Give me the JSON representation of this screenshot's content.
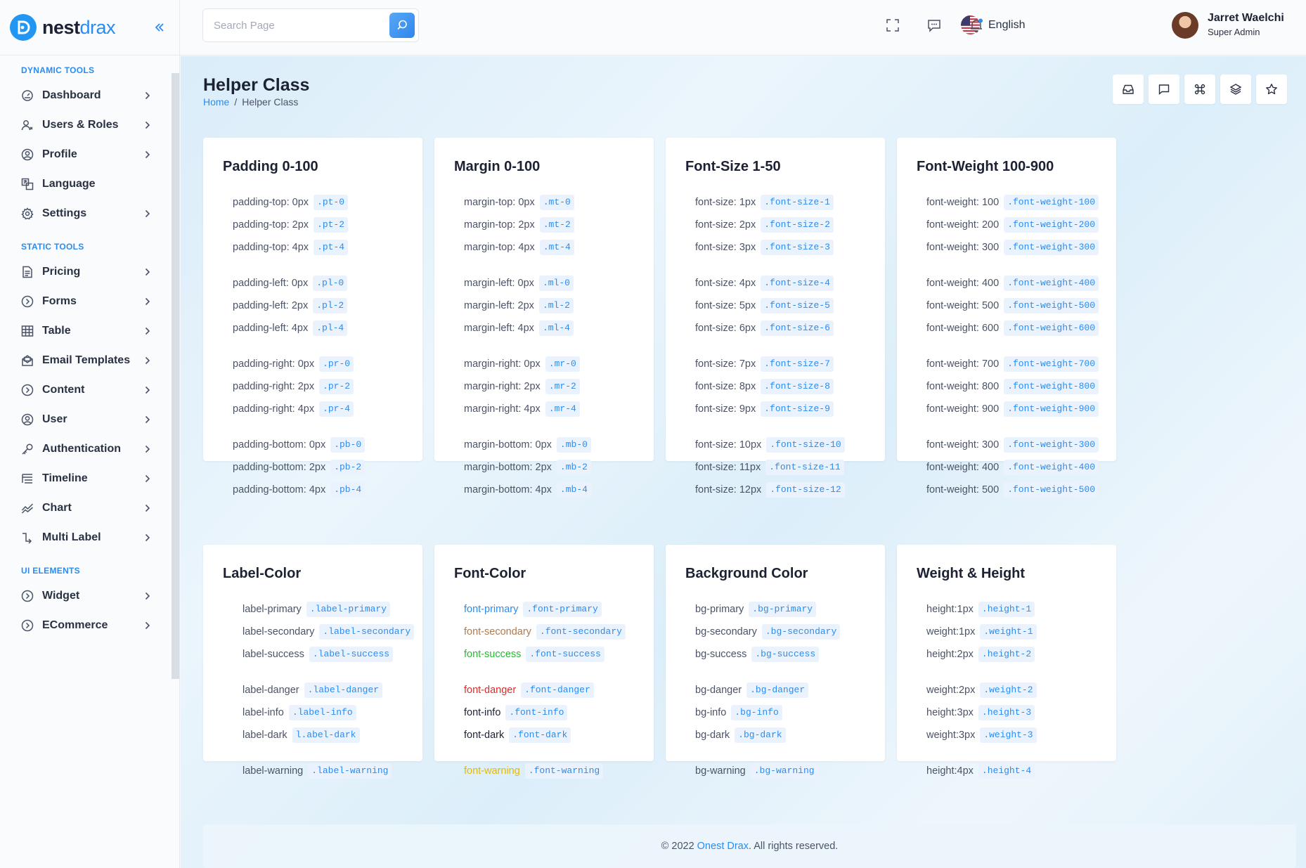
{
  "brand": {
    "name_main": "nest",
    "name_accent": "drax"
  },
  "sidebar": {
    "sections": [
      {
        "title": "DYNAMIC TOOLS",
        "items": [
          {
            "label": "Dashboard",
            "icon": "gauge-icon",
            "chevron": true
          },
          {
            "label": "Users & Roles",
            "icon": "users-icon",
            "chevron": true
          },
          {
            "label": "Profile",
            "icon": "profile-icon",
            "chevron": true
          },
          {
            "label": "Language",
            "icon": "language-icon",
            "chevron": false
          },
          {
            "label": "Settings",
            "icon": "gear-icon",
            "chevron": true
          }
        ]
      },
      {
        "title": "STATIC TOOLS",
        "items": [
          {
            "label": "Pricing",
            "icon": "pricing-icon",
            "chevron": true
          },
          {
            "label": "Forms",
            "icon": "circle-chevron-icon",
            "chevron": true
          },
          {
            "label": "Table",
            "icon": "table-icon",
            "chevron": true
          },
          {
            "label": "Email Templates",
            "icon": "mail-icon",
            "chevron": true
          },
          {
            "label": "Content",
            "icon": "circle-chevron-icon",
            "chevron": true
          },
          {
            "label": "User",
            "icon": "user-icon",
            "chevron": true
          },
          {
            "label": "Authentication",
            "icon": "key-icon",
            "chevron": true
          },
          {
            "label": "Timeline",
            "icon": "timeline-icon",
            "chevron": true
          },
          {
            "label": "Chart",
            "icon": "chart-icon",
            "chevron": true
          },
          {
            "label": "Multi Label",
            "icon": "multi-label-icon",
            "chevron": true
          }
        ]
      },
      {
        "title": "UI ELEMENTS",
        "items": [
          {
            "label": "Widget",
            "icon": "circle-chevron-icon",
            "chevron": true
          },
          {
            "label": "ECommerce",
            "icon": "circle-chevron-icon",
            "chevron": true
          }
        ]
      }
    ]
  },
  "header": {
    "search_placeholder": "Search Page",
    "language": "English",
    "user_name": "Jarret Waelchi",
    "user_role": "Super Admin"
  },
  "page": {
    "title": "Helper Class",
    "breadcrumb_home": "Home",
    "breadcrumb_sep": "/",
    "breadcrumb_current": "Helper Class"
  },
  "colors": {
    "accent": "#2b8cf0",
    "primary": "#2b8cf0",
    "secondary": "#b07a4f",
    "success": "#28b833",
    "danger": "#e02a2a",
    "dark": "#1c2233",
    "warning": "#e6b800"
  },
  "cards": [
    {
      "title": "Padding 0-100",
      "groups": [
        [
          [
            "padding-top: 0px",
            ".pt-0"
          ],
          [
            "padding-top: 2px",
            ".pt-2"
          ],
          [
            "padding-top: 4px",
            ".pt-4"
          ]
        ],
        [
          [
            "padding-left: 0px",
            ".pl-0"
          ],
          [
            "padding-left: 2px",
            ".pl-2"
          ],
          [
            "padding-left: 4px",
            ".pl-4"
          ]
        ],
        [
          [
            "padding-right: 0px",
            ".pr-0"
          ],
          [
            "padding-right: 2px",
            ".pr-2"
          ],
          [
            "padding-right: 4px",
            ".pr-4"
          ]
        ],
        [
          [
            "padding-bottom: 0px",
            ".pb-0"
          ],
          [
            "padding-bottom: 2px",
            ".pb-2"
          ],
          [
            "padding-bottom: 4px",
            ".pb-4"
          ]
        ]
      ]
    },
    {
      "title": "Margin 0-100",
      "groups": [
        [
          [
            "margin-top: 0px",
            ".mt-0"
          ],
          [
            "margin-top: 2px",
            ".mt-2"
          ],
          [
            "margin-top: 4px",
            ".mt-4"
          ]
        ],
        [
          [
            "margin-left: 0px",
            ".ml-0"
          ],
          [
            "margin-left: 2px",
            ".ml-2"
          ],
          [
            "margin-left: 4px",
            ".ml-4"
          ]
        ],
        [
          [
            "margin-right: 0px",
            ".mr-0"
          ],
          [
            "margin-right: 2px",
            ".mr-2"
          ],
          [
            "margin-right: 4px",
            ".mr-4"
          ]
        ],
        [
          [
            "margin-bottom: 0px",
            ".mb-0"
          ],
          [
            "margin-bottom: 2px",
            ".mb-2"
          ],
          [
            "margin-bottom: 4px",
            ".mb-4"
          ]
        ]
      ]
    },
    {
      "title": "Font-Size 1-50",
      "groups": [
        [
          [
            "font-size: 1px",
            ".font-size-1"
          ],
          [
            "font-size: 2px",
            ".font-size-2"
          ],
          [
            "font-size: 3px",
            ".font-size-3"
          ]
        ],
        [
          [
            "font-size: 4px",
            ".font-size-4"
          ],
          [
            "font-size: 5px",
            ".font-size-5"
          ],
          [
            "font-size: 6px",
            ".font-size-6"
          ]
        ],
        [
          [
            "font-size: 7px",
            ".font-size-7"
          ],
          [
            "font-size: 8px",
            ".font-size-8"
          ],
          [
            "font-size: 9px",
            ".font-size-9"
          ]
        ],
        [
          [
            "font-size: 10px",
            ".font-size-10"
          ],
          [
            "font-size: 11px",
            ".font-size-11"
          ],
          [
            "font-size: 12px",
            ".font-size-12"
          ]
        ]
      ]
    },
    {
      "title": "Font-Weight 100-900",
      "groups": [
        [
          [
            "font-weight: 100",
            ".font-weight-100"
          ],
          [
            "font-weight: 200",
            ".font-weight-200"
          ],
          [
            "font-weight: 300",
            ".font-weight-300"
          ]
        ],
        [
          [
            "font-weight: 400",
            ".font-weight-400"
          ],
          [
            "font-weight: 500",
            ".font-weight-500"
          ],
          [
            "font-weight: 600",
            ".font-weight-600"
          ]
        ],
        [
          [
            "font-weight: 700",
            ".font-weight-700"
          ],
          [
            "font-weight: 800",
            ".font-weight-800"
          ],
          [
            "font-weight: 900",
            ".font-weight-900"
          ]
        ],
        [
          [
            "font-weight: 300",
            ".font-weight-300"
          ],
          [
            "font-weight: 400",
            ".font-weight-400"
          ],
          [
            "font-weight: 500",
            ".font-weight-500"
          ]
        ]
      ]
    },
    {
      "title": "Label-Color",
      "groups": [
        [
          [
            "label-primary",
            ".label-primary"
          ],
          [
            "label-secondary",
            ".label-secondary"
          ],
          [
            "label-success",
            ".label-success"
          ]
        ],
        [
          [
            "label-danger",
            ".label-danger"
          ],
          [
            "label-info",
            ".label-info"
          ],
          [
            "label-dark",
            "l.abel-dark"
          ]
        ],
        [
          [
            "label-warning",
            ".label-warning"
          ]
        ]
      ]
    },
    {
      "title": "Font-Color",
      "groups": [
        [
          [
            "font-primary",
            ".font-primary",
            "primary"
          ],
          [
            "font-secondary",
            ".font-secondary",
            "secondary"
          ],
          [
            "font-success",
            ".font-success",
            "success"
          ]
        ],
        [
          [
            "font-danger",
            ".font-danger",
            "danger"
          ],
          [
            "font-info",
            ".font-info",
            "dark"
          ],
          [
            "font-dark",
            ".font-dark",
            "dark"
          ]
        ],
        [
          [
            "font-warning",
            ".font-warning",
            "warning"
          ]
        ]
      ]
    },
    {
      "title": "Background Color",
      "groups": [
        [
          [
            "bg-primary",
            ".bg-primary"
          ],
          [
            "bg-secondary",
            ".bg-secondary"
          ],
          [
            "bg-success",
            ".bg-success"
          ]
        ],
        [
          [
            "bg-danger",
            ".bg-danger"
          ],
          [
            "bg-info",
            ".bg-info"
          ],
          [
            "bg-dark",
            ".bg-dark"
          ]
        ],
        [
          [
            "bg-warning",
            ".bg-warning"
          ]
        ]
      ]
    },
    {
      "title": "Weight & Height",
      "groups": [
        [
          [
            "height:1px",
            ".height-1"
          ],
          [
            "weight:1px",
            ".weight-1"
          ],
          [
            "height:2px",
            ".height-2"
          ]
        ],
        [
          [
            "weight:2px",
            ".weight-2"
          ],
          [
            "height:3px",
            ".height-3"
          ],
          [
            "weight:3px",
            ".weight-3"
          ]
        ],
        [
          [
            "height:4px",
            ".height-4"
          ]
        ]
      ]
    }
  ],
  "footer": {
    "text": "© 2022",
    "brand": "Onest Drax",
    "suffix": ". All rights reserved."
  }
}
